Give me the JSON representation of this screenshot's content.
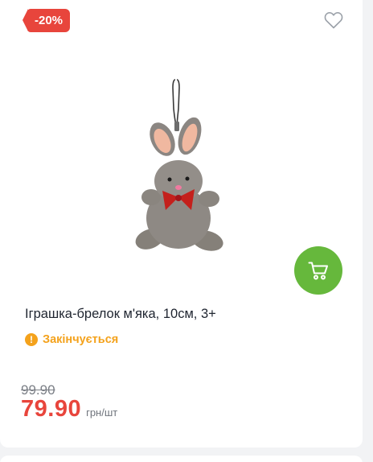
{
  "product": {
    "discount_badge": "-20%",
    "title": "Іграшка-брелок м'яка, 10см, 3+",
    "image_alt": "Іграшка-брелок м'яка, 10см, 3+",
    "status_icon": "!",
    "status": "Закінчується",
    "old_price": "99.90",
    "price": "79.90",
    "unit": "грн/шт"
  },
  "icons": {
    "wishlist": "heart-outline-icon",
    "cart": "shopping-cart-icon",
    "status": "exclamation-circle-icon"
  },
  "colors": {
    "discount": "#e8453c",
    "price": "#e8453c",
    "cart_button": "#66b83c",
    "status": "#f4a21c",
    "old_price": "#7b7f86"
  }
}
